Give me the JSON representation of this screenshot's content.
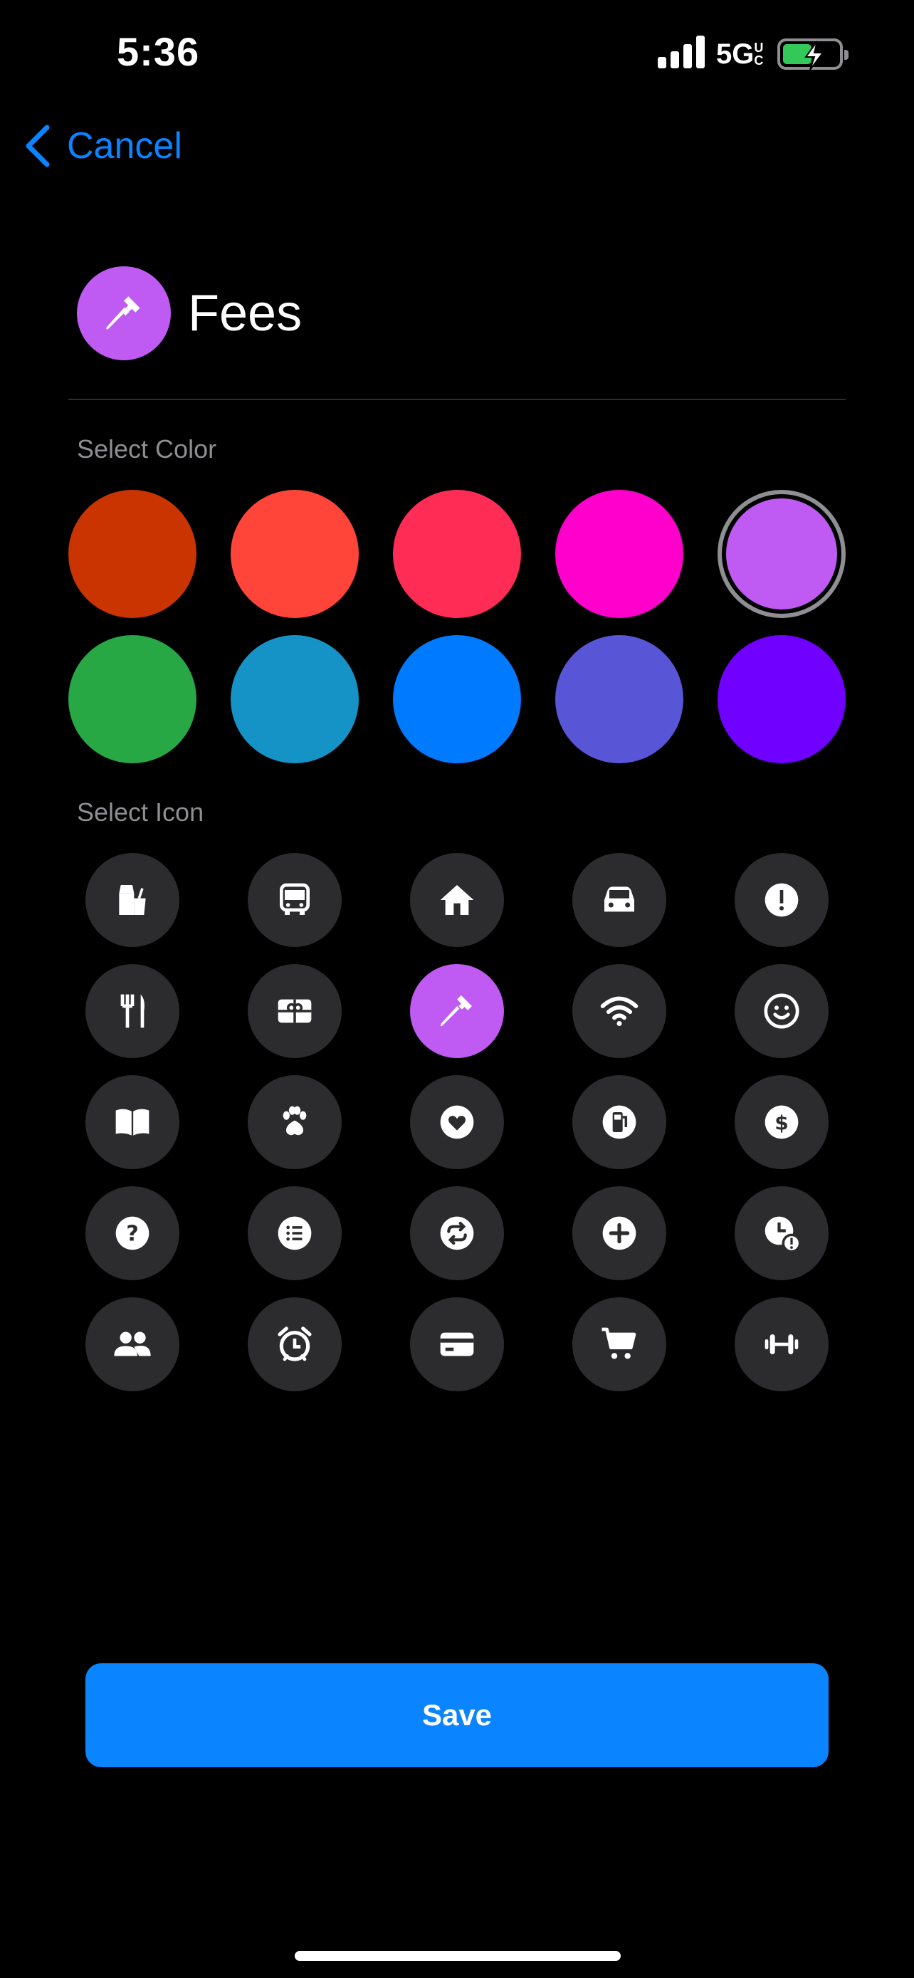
{
  "status_bar": {
    "time": "5:36",
    "network": "5G",
    "network_suffix": "UC"
  },
  "nav": {
    "cancel_label": "Cancel"
  },
  "category": {
    "name": "Fees",
    "icon": "hammer-icon",
    "color": "#bf5af2"
  },
  "color_section": {
    "label": "Select Color",
    "colors": [
      "#c93400",
      "#ff453a",
      "#ff2d55",
      "#ff00cc",
      "#bf5af2",
      "#28a745",
      "#1693c6",
      "#007aff",
      "#5856d6",
      "#7000ff"
    ],
    "selected_index": 4
  },
  "icon_section": {
    "label": "Select Icon",
    "icons": [
      "groceries-icon",
      "bus-icon",
      "house-icon",
      "car-icon",
      "exclamation-icon",
      "fork-knife-icon",
      "gift-card-icon",
      "hammer-icon",
      "wifi-icon",
      "smiley-icon",
      "book-icon",
      "paw-icon",
      "heart-icon",
      "fuel-icon",
      "dollar-icon",
      "question-icon",
      "list-icon",
      "repeat-icon",
      "plus-icon",
      "clock-alert-icon",
      "people-icon",
      "alarm-icon",
      "credit-card-icon",
      "cart-icon",
      "dumbbell-icon"
    ],
    "selected_index": 7
  },
  "save_label": "Save"
}
